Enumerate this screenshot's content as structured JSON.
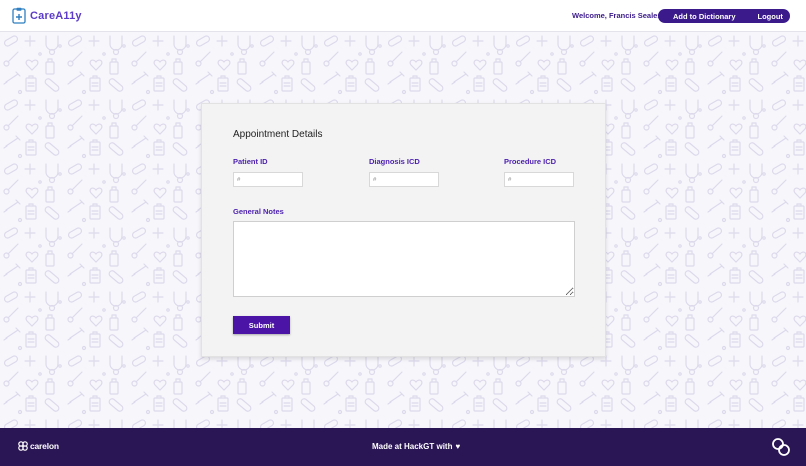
{
  "header": {
    "brand": "CareA11y",
    "welcome": "Welcome, Francis Seales",
    "add_dictionary": "Add to Dictionary",
    "logout": "Logout"
  },
  "form": {
    "title": "Appointment Details",
    "patient_id_label": "Patient ID",
    "patient_id_placeholder": "#",
    "diagnosis_label": "Diagnosis ICD",
    "diagnosis_placeholder": "#",
    "procedure_label": "Procedure ICD",
    "procedure_placeholder": "#",
    "notes_label": "General Notes",
    "notes_value": "",
    "submit_label": "Submit"
  },
  "footer": {
    "logo_text": "carelon",
    "made_with": "Made at HackGT with",
    "heart": "♥"
  },
  "colors": {
    "brand_purple": "#5b3bc8",
    "nav_pill": "#3b1a8c",
    "label_purple": "#4b1fae",
    "submit_bg": "#4b14a6",
    "footer_bg": "#2a1555"
  },
  "icons": {
    "brand": "clipboard-medical-icon",
    "heart": "heart-icon",
    "footer_logo": "carelon-logo-icon",
    "footer_mark": "carelon-mark-icon",
    "background": "medical-doodle-pattern"
  }
}
